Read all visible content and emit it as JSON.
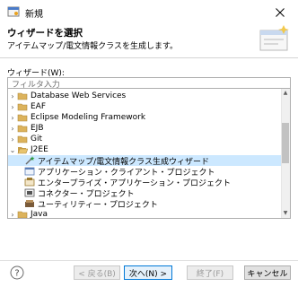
{
  "window": {
    "title": "新規"
  },
  "header": {
    "title": "ウィザードを選択",
    "description": "アイテムマップ/電文情報クラスを生成します。"
  },
  "wizard_label": "ウィザード(W):",
  "filter": {
    "value": "",
    "placeholder": "フィルタ入力"
  },
  "tree": {
    "items": [
      {
        "label": "Database Web Services",
        "icon": "folder-icon",
        "expanded": false
      },
      {
        "label": "EAF",
        "icon": "folder-icon",
        "expanded": false
      },
      {
        "label": "Eclipse Modeling Framework",
        "icon": "folder-icon",
        "expanded": false
      },
      {
        "label": "EJB",
        "icon": "folder-icon",
        "expanded": false
      },
      {
        "label": "Git",
        "icon": "folder-icon",
        "expanded": false
      },
      {
        "label": "J2EE",
        "icon": "folder-open-icon",
        "expanded": true
      },
      {
        "label": "アイテムマップ/電文情報クラス生成ウィザード",
        "icon": "wizard-icon",
        "selected": true
      },
      {
        "label": "アプリケーション・クライアント・プロジェクト",
        "icon": "app-client-project-icon"
      },
      {
        "label": "エンタープライズ・アプリケーション・プロジェクト",
        "icon": "enterprise-app-project-icon"
      },
      {
        "label": "コネクター・プロジェクト",
        "icon": "connector-project-icon"
      },
      {
        "label": "ユーティリティー・プロジェクト",
        "icon": "utility-project-icon"
      },
      {
        "label": "Java",
        "icon": "folder-icon",
        "expanded": false
      }
    ]
  },
  "buttons": {
    "back": "< 戻る(B)",
    "next": "次へ(N) >",
    "finish": "終了(F)",
    "cancel": "キャンセル"
  },
  "colors": {
    "selection": "#cce8ff",
    "default_button_border": "#0078d7",
    "folder": "#dcb35c"
  }
}
